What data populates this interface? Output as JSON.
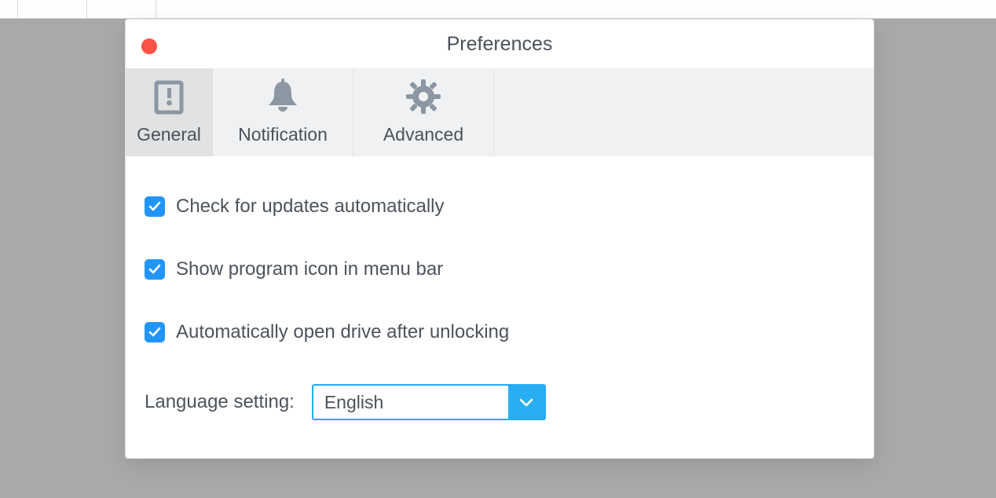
{
  "window": {
    "title": "Preferences"
  },
  "tabs": {
    "general": "General",
    "notification": "Notification",
    "advanced": "Advanced"
  },
  "options": {
    "check_updates": {
      "label": "Check for updates automatically",
      "checked": true
    },
    "show_menubar_icon": {
      "label": "Show program icon in menu bar",
      "checked": true
    },
    "auto_open_drive": {
      "label": "Automatically open drive after unlocking",
      "checked": true
    }
  },
  "language": {
    "label": "Language setting:",
    "value": "English"
  }
}
